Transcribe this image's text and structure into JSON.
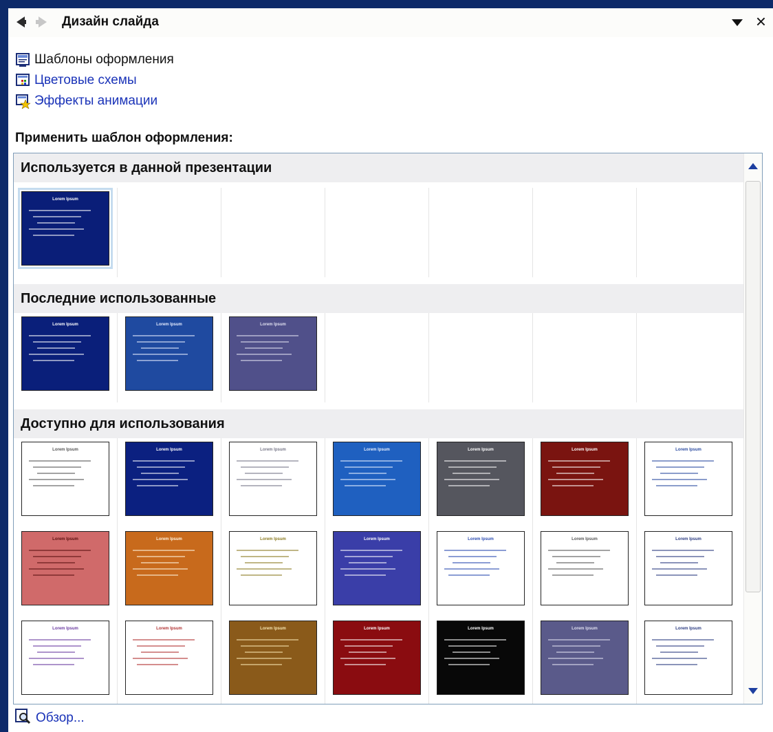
{
  "pane": {
    "title": "Дизайн слайда",
    "back_icon": "back-arrow-icon",
    "forward_icon": "forward-arrow-icon",
    "menu_icon": "chevron-down-icon",
    "close_icon": "close-icon",
    "close_glyph": "×"
  },
  "links": [
    {
      "label": "Шаблоны оформления",
      "icon": "design-templates-icon",
      "color": "#111111"
    },
    {
      "label": "Цветовые схемы",
      "icon": "color-schemes-icon",
      "color": "#1a33b8"
    },
    {
      "label": "Эффекты анимации",
      "icon": "animation-effects-icon",
      "color": "#1a33b8"
    }
  ],
  "apply_label": "Применить шаблон оформления:",
  "gallery": {
    "groups": [
      {
        "header": "Используется в данной презентации",
        "templates": [
          {
            "title": "Lorem Ipsum",
            "bg": "#0a1e78",
            "fg": "#ffffff",
            "selected": true
          }
        ]
      },
      {
        "header": "Последние использованные",
        "templates": [
          {
            "title": "Lorem Ipsum",
            "bg": "#0a1f7a",
            "fg": "#ffffff",
            "selected": false
          },
          {
            "title": "Lorem Ipsum",
            "bg": "#1f4aa0",
            "fg": "#e6ecff",
            "selected": false
          },
          {
            "title": "Lorem Ipsum",
            "bg": "#50508a",
            "fg": "#e0e0f0",
            "selected": false
          }
        ]
      },
      {
        "header": "Доступно для использования",
        "templates": [
          {
            "title": "Lorem Ipsum",
            "bg": "#ffffff",
            "fg": "#555555",
            "selected": false
          },
          {
            "title": "Lorem Ipsum",
            "bg": "#0b2080",
            "fg": "#ffffff",
            "selected": false
          },
          {
            "title": "Lorem Ipsum",
            "bg": "#ffffff",
            "fg": "#777788",
            "selected": false
          },
          {
            "title": "Lorem Ipsum",
            "bg": "#1f60c0",
            "fg": "#e8f0ff",
            "selected": false
          },
          {
            "title": "Lorem Ipsum",
            "bg": "#55565e",
            "fg": "#ffffff",
            "selected": false
          },
          {
            "title": "Lorem Ipsum",
            "bg": "#7a1410",
            "fg": "#ffffff",
            "selected": false
          },
          {
            "title": "Lorem Ipsum",
            "bg": "#ffffff",
            "fg": "#2a4aa0",
            "selected": false
          },
          {
            "title": "Lorem Ipsum",
            "bg": "#d06a6a",
            "fg": "#5a1010",
            "selected": false
          },
          {
            "title": "Lorem Ipsum",
            "bg": "#c86a1c",
            "fg": "#fff4e0",
            "selected": false
          },
          {
            "title": "Lorem Ipsum",
            "bg": "#ffffff",
            "fg": "#8a7a20",
            "selected": false
          },
          {
            "title": "Lorem Ipsum",
            "bg": "#3a3ea8",
            "fg": "#ffffff",
            "selected": false
          },
          {
            "title": "Lorem Ipsum",
            "bg": "#ffffff",
            "fg": "#2a4ab0",
            "selected": false
          },
          {
            "title": "Lorem Ipsum",
            "bg": "#ffffff",
            "fg": "#555555",
            "selected": false
          },
          {
            "title": "Lorem Ipsum",
            "bg": "#ffffff",
            "fg": "#2a3a80",
            "selected": false
          },
          {
            "title": "Lorem Ipsum",
            "bg": "#ffffff",
            "fg": "#6a3aa0",
            "selected": false
          },
          {
            "title": "Lorem Ipsum",
            "bg": "#ffffff",
            "fg": "#b03030",
            "selected": false
          },
          {
            "title": "Lorem Ipsum",
            "bg": "#8a5a1a",
            "fg": "#f7e6b0",
            "selected": false
          },
          {
            "title": "Lorem Ipsum",
            "bg": "#8a0c10",
            "fg": "#ffffff",
            "selected": false
          },
          {
            "title": "Lorem Ipsum",
            "bg": "#080808",
            "fg": "#ffffff",
            "selected": false
          },
          {
            "title": "Lorem Ipsum",
            "bg": "#5a5a8a",
            "fg": "#e0e0f0",
            "selected": false
          },
          {
            "title": "Lorem Ipsum",
            "bg": "#ffffff",
            "fg": "#2a3a80",
            "selected": false
          }
        ]
      }
    ]
  },
  "browse": {
    "label": "Обзор...",
    "icon": "browse-magnifier-icon"
  }
}
